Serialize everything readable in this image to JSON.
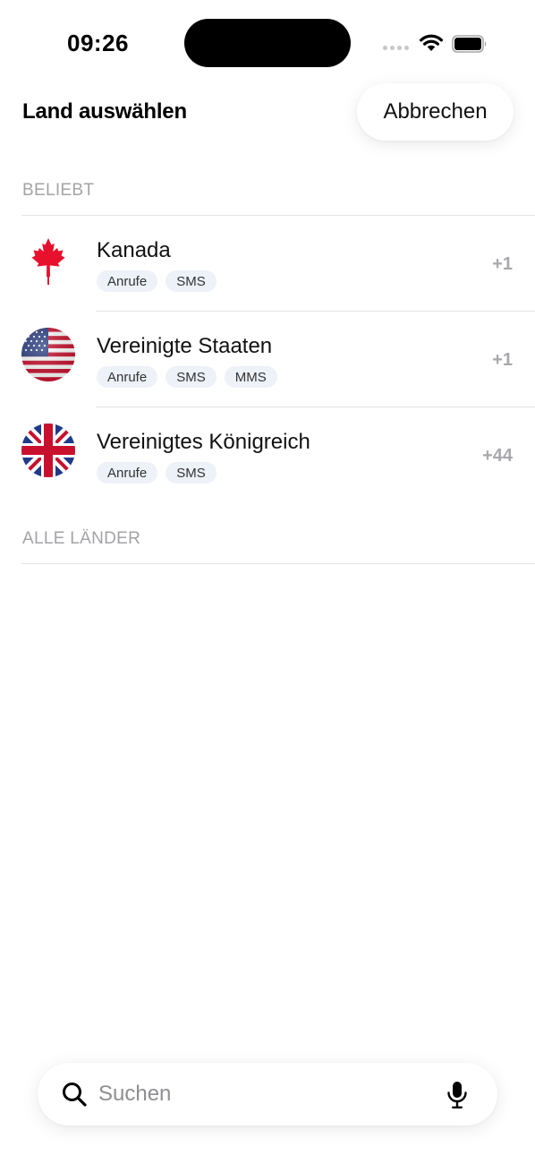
{
  "status_bar": {
    "time": "09:26"
  },
  "header": {
    "title": "Land auswählen",
    "cancel_label": "Abbrechen"
  },
  "sections": {
    "popular_label": "BELIEBT",
    "all_label": "ALLE LÄNDER"
  },
  "countries": [
    {
      "name": "Kanada",
      "code": "+1",
      "flag": "canada-flag-icon",
      "tags": [
        "Anrufe",
        "SMS"
      ]
    },
    {
      "name": "Vereinigte Staaten",
      "code": "+1",
      "flag": "usa-flag-icon",
      "tags": [
        "Anrufe",
        "SMS",
        "MMS"
      ]
    },
    {
      "name": "Vereinigtes Königreich",
      "code": "+44",
      "flag": "uk-flag-icon",
      "tags": [
        "Anrufe",
        "SMS"
      ]
    }
  ],
  "search": {
    "placeholder": "Suchen",
    "value": ""
  },
  "icons": {
    "search": "search-icon",
    "mic": "microphone-icon",
    "wifi": "wifi-icon",
    "battery": "battery-icon",
    "signal": "signal-icon"
  },
  "colors": {
    "tag_bg": "#edf1f8",
    "muted_text": "#a8a8ad",
    "divider": "#e4e4e7"
  }
}
